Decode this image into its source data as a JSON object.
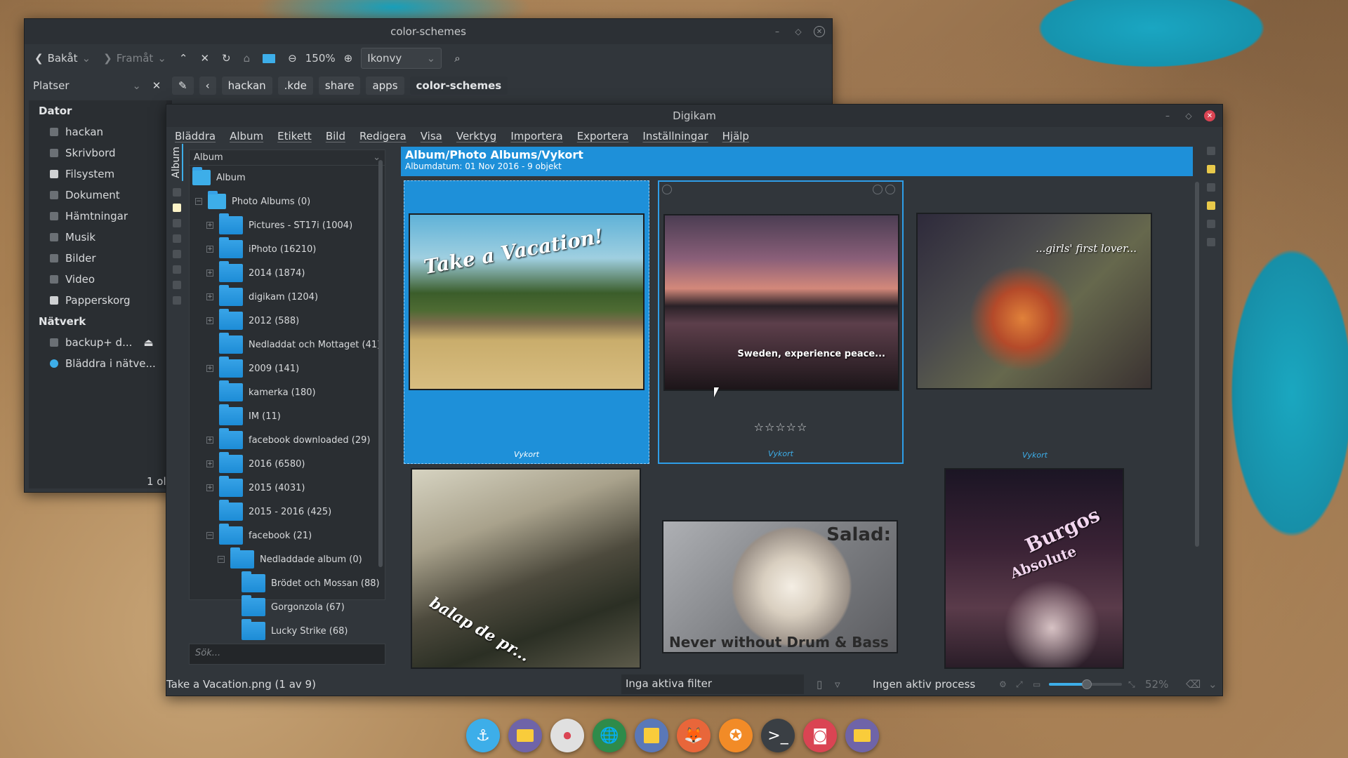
{
  "fm": {
    "title": "color-schemes",
    "back": "Bakåt",
    "forward": "Framåt",
    "zoom": "150%",
    "view_mode": "Ikonvy",
    "places_label": "Platser",
    "breadcrumbs": [
      "hackan",
      ".kde",
      "share",
      "apps",
      "color-schemes"
    ],
    "places": {
      "dator": "Dator",
      "dator_items": [
        "hackan",
        "Skrivbord",
        "Filsystem",
        "Dokument",
        "Hämtningar",
        "Musik",
        "Bilder",
        "Video",
        "Papperskorg"
      ],
      "natverk": "Nätverk",
      "natverk_items": [
        "backup+ d...",
        "Bläddra i nätve..."
      ]
    },
    "status_fragment": "1 ol"
  },
  "dk": {
    "title": "Digikam",
    "menu": [
      "Bläddra",
      "Album",
      "Etikett",
      "Bild",
      "Redigera",
      "Visa",
      "Verktyg",
      "Importera",
      "Exportera",
      "Inställningar",
      "Hjälp"
    ],
    "side_tab": "Album",
    "tree_combo": "Album",
    "tree": [
      {
        "label": "Album",
        "level": 0,
        "exp": ""
      },
      {
        "label": "Photo Albums (0)",
        "level": 1,
        "exp": "−"
      },
      {
        "label": "Pictures - ST17i (1004)",
        "level": 2,
        "exp": "+"
      },
      {
        "label": "iPhoto (16210)",
        "level": 2,
        "exp": "+"
      },
      {
        "label": "2014 (1874)",
        "level": 2,
        "exp": "+"
      },
      {
        "label": "digikam (1204)",
        "level": 2,
        "exp": "+"
      },
      {
        "label": "2012 (588)",
        "level": 2,
        "exp": "+"
      },
      {
        "label": "Nedladdat och Mottaget (41)",
        "level": 2,
        "exp": ""
      },
      {
        "label": "2009 (141)",
        "level": 2,
        "exp": "+"
      },
      {
        "label": "kamerka (180)",
        "level": 2,
        "exp": ""
      },
      {
        "label": "IM (11)",
        "level": 2,
        "exp": ""
      },
      {
        "label": "facebook downloaded (29)",
        "level": 2,
        "exp": "+"
      },
      {
        "label": "2016 (6580)",
        "level": 2,
        "exp": "+"
      },
      {
        "label": "2015 (4031)",
        "level": 2,
        "exp": "+"
      },
      {
        "label": "2015 - 2016 (425)",
        "level": 2,
        "exp": ""
      },
      {
        "label": "facebook (21)",
        "level": 2,
        "exp": "−"
      },
      {
        "label": "Nedladdade album (0)",
        "level": 3,
        "exp": "−"
      },
      {
        "label": "Brödet och Mossan (88)",
        "level": 4,
        "exp": ""
      },
      {
        "label": "Gorgonzola (67)",
        "level": 4,
        "exp": ""
      },
      {
        "label": "Lucky Strike (68)",
        "level": 4,
        "exp": ""
      }
    ],
    "search_placeholder": "Sök...",
    "album_title": "Album/Photo Albums/Vykort",
    "album_sub": "Albumdatum: 01 Nov 2016 - 9 objekt",
    "thumbs": [
      {
        "caption": "Vykort",
        "text": "Take a Vacation!"
      },
      {
        "caption": "Vykort",
        "text": "Sweden, experience peace...",
        "stars": "☆☆☆☆☆"
      },
      {
        "caption": "Vykort",
        "text": "...girls' first lover..."
      },
      {
        "caption": "",
        "text": "balap de pr..."
      },
      {
        "caption": "",
        "text": "Salad:",
        "text2": "Never without Drum & Bass"
      },
      {
        "caption": "",
        "text": "Burgos",
        "text2": "Absolute"
      }
    ],
    "status_file": "Take a Vacation.png (1 av 9)",
    "status_filter": "Inga aktiva filter",
    "status_process": "Ingen aktiv process",
    "status_zoom": "52%",
    "zoom_slider_value": 0.52
  },
  "dock_icons": [
    "anchor-icon",
    "folder-icon",
    "toggle-icon",
    "globe-icon",
    "archive-icon",
    "firefox-icon",
    "compass-icon",
    "terminal-icon",
    "camera-icon",
    "folder-yellow-icon"
  ],
  "colors": {
    "accent": "#1e90d9",
    "window_bg": "#31363b",
    "close_red": "#da4453"
  }
}
